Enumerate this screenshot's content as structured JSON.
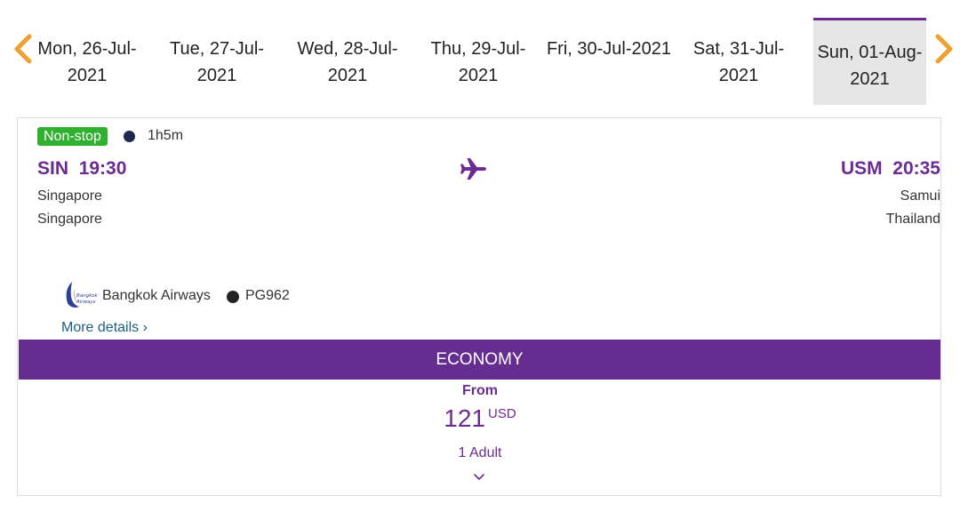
{
  "date_strip": {
    "prev_icon": "chevron-left-icon",
    "next_icon": "chevron-right-icon",
    "arrow_color": "#f0a030",
    "dates": [
      {
        "line1": "Mon, 26-Jul-",
        "line2": "2021",
        "selected": false
      },
      {
        "line1": "Tue, 27-Jul-",
        "line2": "2021",
        "selected": false
      },
      {
        "line1": "Wed, 28-Jul-",
        "line2": "2021",
        "selected": false
      },
      {
        "line1": "Thu, 29-Jul-",
        "line2": "2021",
        "selected": false
      },
      {
        "line1": "Fri, 30-Jul-2021",
        "line2": "",
        "selected": false
      },
      {
        "line1": "Sat, 31-Jul-",
        "line2": "2021",
        "selected": false
      },
      {
        "line1": "Sun, 01-Aug-",
        "line2": "2021",
        "selected": true
      }
    ]
  },
  "flight": {
    "stops_label": "Non-stop",
    "duration": "1h5m",
    "departure": {
      "code": "SIN",
      "time": "19:30",
      "city": "Singapore",
      "country": "Singapore"
    },
    "arrival": {
      "code": "USM",
      "time": "20:35",
      "city": "Samui",
      "country": "Thailand"
    },
    "airline": "Bangkok Airways",
    "flight_number": "PG962",
    "more_details": "More details ›"
  },
  "fare": {
    "cabin": "ECONOMY",
    "from_label": "From",
    "amount": "121",
    "currency": "USD",
    "passengers": "1 Adult"
  },
  "colors": {
    "brand_purple": "#662d91",
    "nonstop_green": "#2fb12f",
    "link_blue": "#1e5d84"
  }
}
